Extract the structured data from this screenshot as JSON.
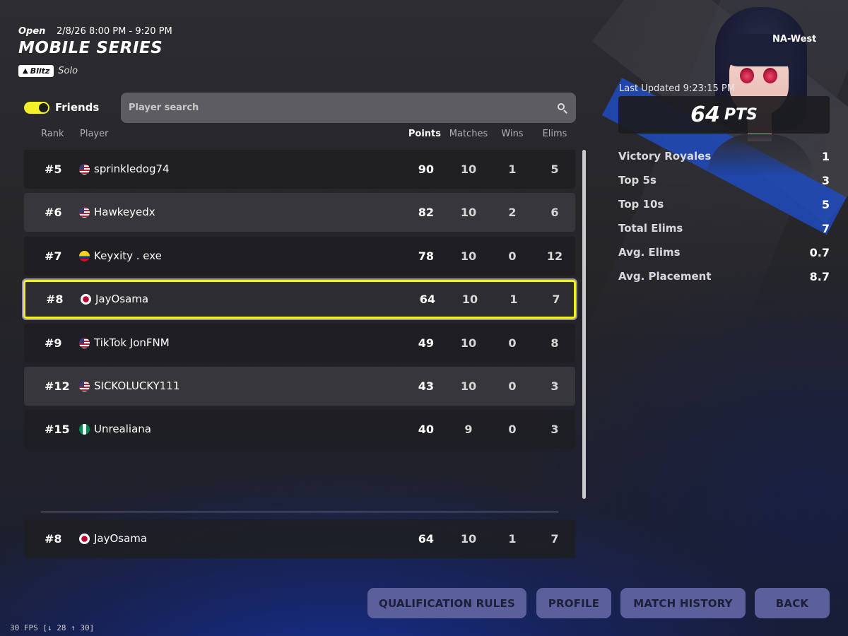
{
  "header": {
    "status": "Open",
    "time": "2/8/26 8:00 PM - 9:20 PM",
    "title": "MOBILE SERIES",
    "mode_badge": "Blitz",
    "mode_type": "Solo",
    "region": "NA-West"
  },
  "filters": {
    "friends_label": "Friends",
    "friends_on": true,
    "search_placeholder": "Player search"
  },
  "columns": {
    "rank": "Rank",
    "player": "Player",
    "points": "Points",
    "matches": "Matches",
    "wins": "Wins",
    "elims": "Elims"
  },
  "rows": [
    {
      "rank": "#5",
      "flag": "us",
      "name": "sprinkledog74",
      "points": "90",
      "matches": "10",
      "wins": "1",
      "elims": "5"
    },
    {
      "rank": "#6",
      "flag": "us",
      "name": "Hawkeyedx",
      "points": "82",
      "matches": "10",
      "wins": "2",
      "elims": "6"
    },
    {
      "rank": "#7",
      "flag": "co",
      "name": "Keyxity . exe",
      "points": "78",
      "matches": "10",
      "wins": "0",
      "elims": "12"
    },
    {
      "rank": "#8",
      "flag": "jp",
      "name": "JayOsama",
      "points": "64",
      "matches": "10",
      "wins": "1",
      "elims": "7",
      "highlighted": true
    },
    {
      "rank": "#9",
      "flag": "us",
      "name": "TikTok JonFNM",
      "points": "49",
      "matches": "10",
      "wins": "0",
      "elims": "8"
    },
    {
      "rank": "#12",
      "flag": "us",
      "name": "SICKOLUCKY111",
      "points": "43",
      "matches": "10",
      "wins": "0",
      "elims": "3"
    },
    {
      "rank": "#15",
      "flag": "ng",
      "name": "Unrealiana",
      "points": "40",
      "matches": "9",
      "wins": "0",
      "elims": "3"
    }
  ],
  "my_row": {
    "rank": "#8",
    "flag": "jp",
    "name": "JayOsama",
    "points": "64",
    "matches": "10",
    "wins": "1",
    "elims": "7"
  },
  "summary": {
    "last_updated": "Last Updated 9:23:15 PM",
    "points_value": "64",
    "points_unit": "PTS",
    "stats": [
      {
        "label": "Victory Royales",
        "value": "1"
      },
      {
        "label": "Top 5s",
        "value": "3"
      },
      {
        "label": "Top 10s",
        "value": "5"
      },
      {
        "label": "Total Elims",
        "value": "7"
      },
      {
        "label": "Avg. Elims",
        "value": "0.7"
      },
      {
        "label": "Avg. Placement",
        "value": "8.7"
      }
    ]
  },
  "buttons": {
    "qualification_rules": "QUALIFICATION RULES",
    "profile": "PROFILE",
    "match_history": "MATCH HISTORY",
    "back": "BACK"
  },
  "fps_counter": "30 FPS [↓ 28 ↑ 30]",
  "colors": {
    "highlight": "#f2ee22",
    "toggle_on": "#f3f02a",
    "button_bg": "#5b5f9c",
    "button_text": "#1c1f3a"
  }
}
